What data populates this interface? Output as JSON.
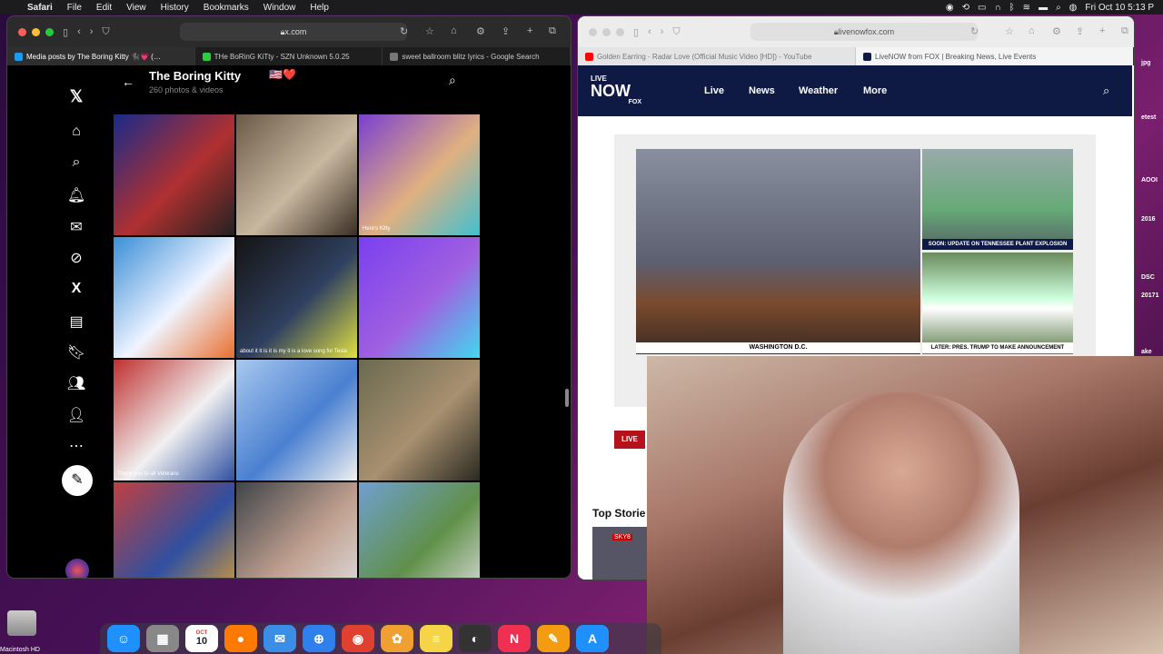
{
  "menubar": {
    "items": [
      "Safari",
      "File",
      "Edit",
      "View",
      "History",
      "Bookmarks",
      "Window",
      "Help"
    ],
    "clock": "Fri Oct 10  5:13 P"
  },
  "left_browser": {
    "url": "x.com",
    "tabs": [
      {
        "title": "Media posts by The Boring Kitty 🐈‍⬛💗 (…",
        "favicon_color": "#1d9bf0"
      },
      {
        "title": "THe BoRinG KiTty - SZN Unknown 5.0.25",
        "favicon_color": "#2ecc40"
      },
      {
        "title": "sweet ballroom blitz lyrics - Google Search",
        "favicon_color": "#777777"
      }
    ],
    "profile": {
      "name": "The Boring Kitty",
      "flags": "🇺🇸❤️",
      "subtitle": "260 photos & videos"
    },
    "sidebar_icons": [
      "x-logo-icon",
      "home-icon",
      "search-icon",
      "notifications-icon",
      "messages-icon",
      "grok-icon",
      "premium-x-icon",
      "lists-icon",
      "bookmarks-icon",
      "communities-icon",
      "profile-icon",
      "more-icon"
    ],
    "grid": [
      {
        "name": "media-chair-collage",
        "colors": [
          "#1a2a8a",
          "#b03030",
          "#222"
        ],
        "caption": ""
      },
      {
        "name": "media-framed-photos-wall",
        "colors": [
          "#6b5a48",
          "#c9b8a0",
          "#3a2e24"
        ],
        "caption": ""
      },
      {
        "name": "media-heres-kitty-collage",
        "colors": [
          "#7a3fd0",
          "#e0b080",
          "#40c0d0"
        ],
        "caption": "Here's Kitty"
      },
      {
        "name": "media-cinderella-cat",
        "colors": [
          "#3a8fd8",
          "#f0f4ff",
          "#e87030"
        ],
        "caption": ""
      },
      {
        "name": "media-love-song-screenshot",
        "colors": [
          "#141414",
          "#304060",
          "#e0e040"
        ],
        "caption": "about it it is it is my it is a love song for Tesla"
      },
      {
        "name": "media-text-gradient-post",
        "colors": [
          "#7a40f0",
          "#a060e0",
          "#40d8f0"
        ],
        "caption": ""
      },
      {
        "name": "media-thank-you-veterans",
        "colors": [
          "#c03030",
          "#f0f0f0",
          "#3050a0"
        ],
        "caption": "Thank you to all Veterans"
      },
      {
        "name": "media-blue-cat-hug",
        "colors": [
          "#a8c8f0",
          "#4a80d0",
          "#f0f0f0"
        ],
        "caption": ""
      },
      {
        "name": "media-selfie-with-cat",
        "colors": [
          "#6a6a50",
          "#a89070",
          "#2a2a20"
        ],
        "caption": ""
      },
      {
        "name": "media-cat-book-cover",
        "colors": [
          "#c04040",
          "#3050a0",
          "#e0a030"
        ],
        "caption": ""
      },
      {
        "name": "media-tattooed-woman",
        "colors": [
          "#404448",
          "#c0a090",
          "#e0e0e0"
        ],
        "caption": ""
      },
      {
        "name": "media-cats-field-collage",
        "colors": [
          "#70a0d0",
          "#60904a",
          "#e0e0e0"
        ],
        "caption": ""
      }
    ]
  },
  "right_browser": {
    "url": "livenowfox.com",
    "tabs": [
      {
        "title": "Golden Earring - Radar Love (Official Music Video [HD]) - YouTube",
        "favicon_color": "#ff0000"
      },
      {
        "title": "LiveNOW from FOX | Breaking News, Live Events",
        "favicon_color": "#0e1a44"
      }
    ],
    "logo": {
      "top": "LIVE",
      "main": "NOW",
      "sub": "FOX"
    },
    "nav": [
      "Live",
      "News",
      "Weather",
      "More"
    ],
    "chyrons": {
      "main": "WASHINGTON D.C.",
      "side1": "SOON: UPDATE ON TENNESSEE PLANT EXPLOSION",
      "side2": "LATER: PRES. TRUMP TO MAKE ANNOUNCEMENT"
    },
    "live_label": "LIVE",
    "top_stories": "Top Storie",
    "thumb_badge": "SKY8"
  },
  "desktop": {
    "hd_label": "Macintosh HD",
    "peek_texts": [
      "jpg",
      "etest",
      "AOOI",
      "2016",
      "DSC",
      "20171",
      "ake"
    ]
  },
  "dock": {
    "apps": [
      {
        "name": "finder",
        "color": "#1e90ff",
        "glyph": "☺"
      },
      {
        "name": "launchpad",
        "color": "#888888",
        "glyph": "▦"
      },
      {
        "name": "calendar",
        "color": "#ffffff",
        "glyph": "10"
      },
      {
        "name": "firefox",
        "color": "#ff7a00",
        "glyph": "●"
      },
      {
        "name": "mail",
        "color": "#3a8ee6",
        "glyph": "✉"
      },
      {
        "name": "safari",
        "color": "#2f80ed",
        "glyph": "⊕"
      },
      {
        "name": "chrome",
        "color": "#e04030",
        "glyph": "◉"
      },
      {
        "name": "photos",
        "color": "#f0a030",
        "glyph": "✿"
      },
      {
        "name": "notes",
        "color": "#f5d545",
        "glyph": "≡"
      },
      {
        "name": "obs",
        "color": "#333333",
        "glyph": "◐"
      },
      {
        "name": "news",
        "color": "#f03050",
        "glyph": "N"
      },
      {
        "name": "pages",
        "color": "#f39c12",
        "glyph": "✎"
      },
      {
        "name": "app-store",
        "color": "#1e90ff",
        "glyph": "A"
      }
    ],
    "calendar_month": "OCT"
  }
}
